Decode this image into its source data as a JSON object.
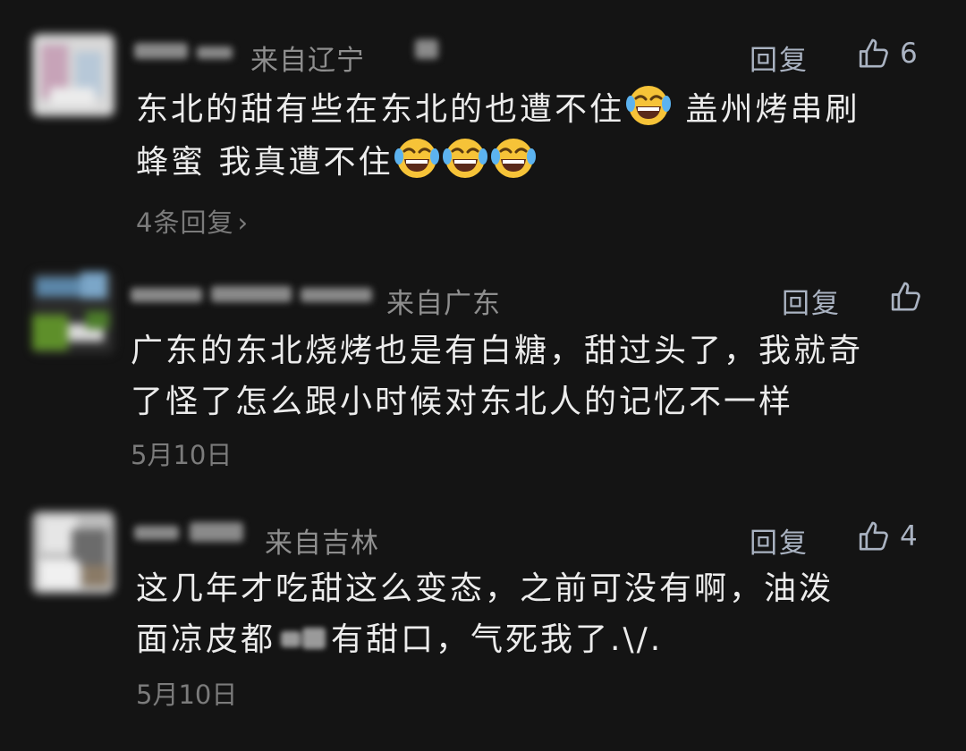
{
  "comments": [
    {
      "location": "来自辽宁",
      "reply_label": "回复",
      "likes": "6",
      "line1_a": "东北的甜有些在东北的也遭不住",
      "line1_b": " 盖州烤串刷",
      "line2_a": "蜂蜜 我真遭不住",
      "emoji": "face-with-tears-of-joy",
      "more_replies": "4条回复",
      "chevron": "›"
    },
    {
      "location": "来自广东",
      "reply_label": "回复",
      "line1": "广东的东北烧烤也是有白糖，甜过头了，我就奇",
      "line2": "了怪了怎么跟小时候对东北人的记忆不一样",
      "date": "5月10日"
    },
    {
      "location": "来自吉林",
      "reply_label": "回复",
      "likes": "4",
      "line1": "这几年才吃甜这么变态，之前可没有啊，油泼",
      "line2_a": "面凉皮都",
      "line2_b": "有甜口，气死我了.\\/.",
      "date": "5月10日"
    }
  ]
}
